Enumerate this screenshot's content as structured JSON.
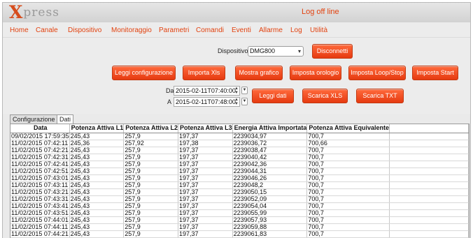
{
  "app": {
    "logo_x": "X",
    "logo_rest": "press",
    "status": "Log off line"
  },
  "menu": [
    "Home",
    "Canale",
    "Dispositivo",
    "Monitoraggio",
    "Parametri",
    "Comandi",
    "Eventi",
    "Allarme",
    "Log",
    "Utilità"
  ],
  "device": {
    "label": "Dispositivo",
    "selected": "DMG800",
    "disconnect_label": "Disconnetti"
  },
  "actions": [
    "Leggi configurazione",
    "Importa Xls",
    "Mostra grafico",
    "Imposta orologio",
    "Imposta Loop/Stop",
    "Imposta Start"
  ],
  "range": {
    "from_label": "Da",
    "from_value": "2015-02-11T07:40:00",
    "to_label": "A",
    "to_value": "2015-02-11T07:48:00"
  },
  "data_actions": [
    "Leggi dati",
    "Scarica XLS",
    "Scarica TXT"
  ],
  "tabs": [
    {
      "label": "Configurazione",
      "active": false
    },
    {
      "label": "Dati",
      "active": true
    }
  ],
  "table": {
    "columns": [
      "Data",
      "Potenza Attiva L1",
      "Potenza Attiva L2",
      "Potenza Attiva L3",
      "Energia Attiva Importata",
      "Potenza Attiva Equivalente",
      ""
    ],
    "rows": [
      [
        "09/02/2015 17:59:35",
        "245,43",
        "257,9",
        "197,37",
        "2239034,97",
        "700,7",
        ""
      ],
      [
        "11/02/2015 07:42:11",
        "245,36",
        "257,92",
        "197,38",
        "2239036,72",
        "700,66",
        ""
      ],
      [
        "11/02/2015 07:42:21",
        "245,43",
        "257,9",
        "197,37",
        "2239038,47",
        "700,7",
        ""
      ],
      [
        "11/02/2015 07:42:31",
        "245,43",
        "257,9",
        "197,37",
        "2239040,42",
        "700,7",
        ""
      ],
      [
        "11/02/2015 07:42:41",
        "245,43",
        "257,9",
        "197,37",
        "2239042,36",
        "700,7",
        ""
      ],
      [
        "11/02/2015 07:42:51",
        "245,43",
        "257,9",
        "197,37",
        "2239044,31",
        "700,7",
        ""
      ],
      [
        "11/02/2015 07:43:01",
        "245,43",
        "257,9",
        "197,37",
        "2239046,26",
        "700,7",
        ""
      ],
      [
        "11/02/2015 07:43:11",
        "245,43",
        "257,9",
        "197,37",
        "2239048,2",
        "700,7",
        ""
      ],
      [
        "11/02/2015 07:43:21",
        "245,43",
        "257,9",
        "197,37",
        "2239050,15",
        "700,7",
        ""
      ],
      [
        "11/02/2015 07:43:31",
        "245,43",
        "257,9",
        "197,37",
        "2239052,09",
        "700,7",
        ""
      ],
      [
        "11/02/2015 07:43:41",
        "245,43",
        "257,9",
        "197,37",
        "2239054,04",
        "700,7",
        ""
      ],
      [
        "11/02/2015 07:43:51",
        "245,43",
        "257,9",
        "197,37",
        "2239055,99",
        "700,7",
        ""
      ],
      [
        "11/02/2015 07:44:01",
        "245,43",
        "257,9",
        "197,37",
        "2239057,93",
        "700,7",
        ""
      ],
      [
        "11/02/2015 07:44:11",
        "245,43",
        "257,9",
        "197,37",
        "2239059,88",
        "700,7",
        ""
      ],
      [
        "11/02/2015 07:44:21",
        "245,43",
        "257,9",
        "197,37",
        "2239061,83",
        "700,7",
        ""
      ]
    ]
  },
  "colors": {
    "accent": "#e2420f",
    "button": "#f04a1c",
    "window_bg": "#eaeaea"
  }
}
